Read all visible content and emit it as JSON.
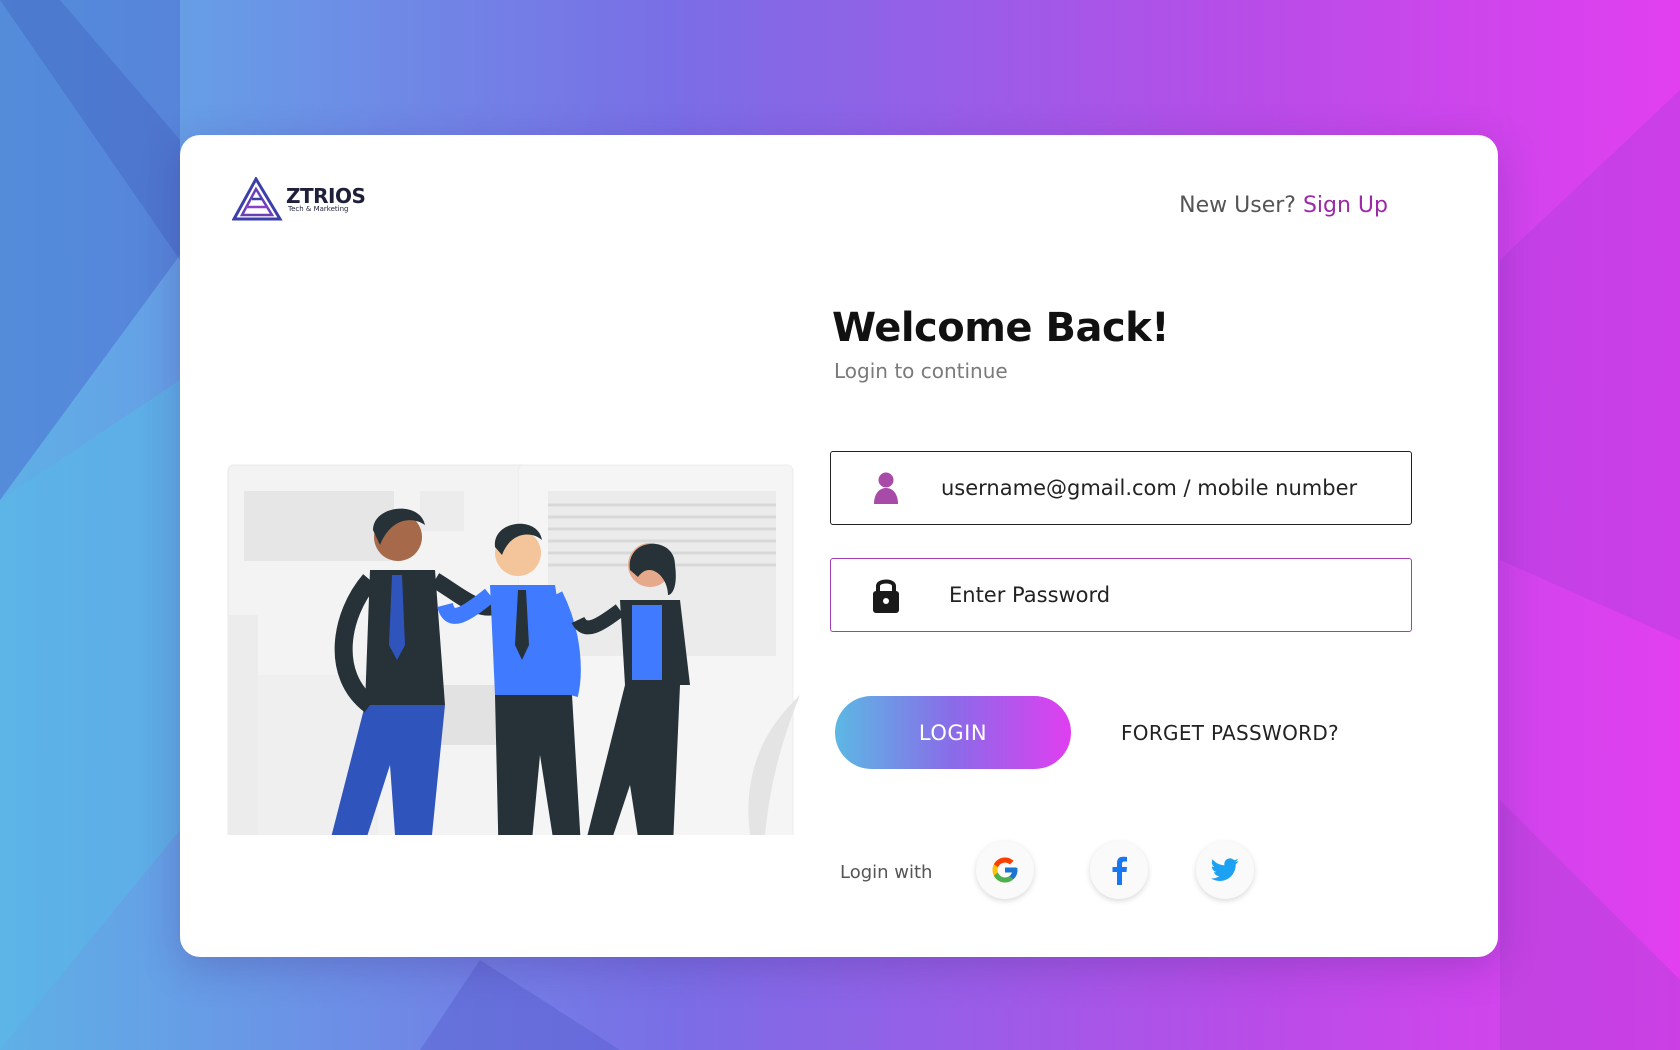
{
  "brand": {
    "name": "ZTRIOS",
    "tagline": "Tech & Marketing"
  },
  "header": {
    "new_user_text": "New User? ",
    "signup_label": "Sign Up"
  },
  "form": {
    "title": "Welcome Back!",
    "subtitle": "Login to continue",
    "username_placeholder": "username@gmail.com / mobile number",
    "password_placeholder": "Enter Password",
    "login_label": "LOGIN",
    "forget_label": "FORGET PASSWORD?"
  },
  "social": {
    "label": "Login with",
    "providers": [
      {
        "name": "Google",
        "icon": "google-icon"
      },
      {
        "name": "Facebook",
        "icon": "facebook-icon"
      },
      {
        "name": "Twitter",
        "icon": "twitter-icon"
      }
    ]
  },
  "colors": {
    "accent": "#9b2aa6",
    "password_border": "#a23fb0",
    "button_gradient_start": "#5cb8e4",
    "button_gradient_end": "#e03ef0",
    "facebook": "#1877f2",
    "twitter": "#1da1f2"
  }
}
